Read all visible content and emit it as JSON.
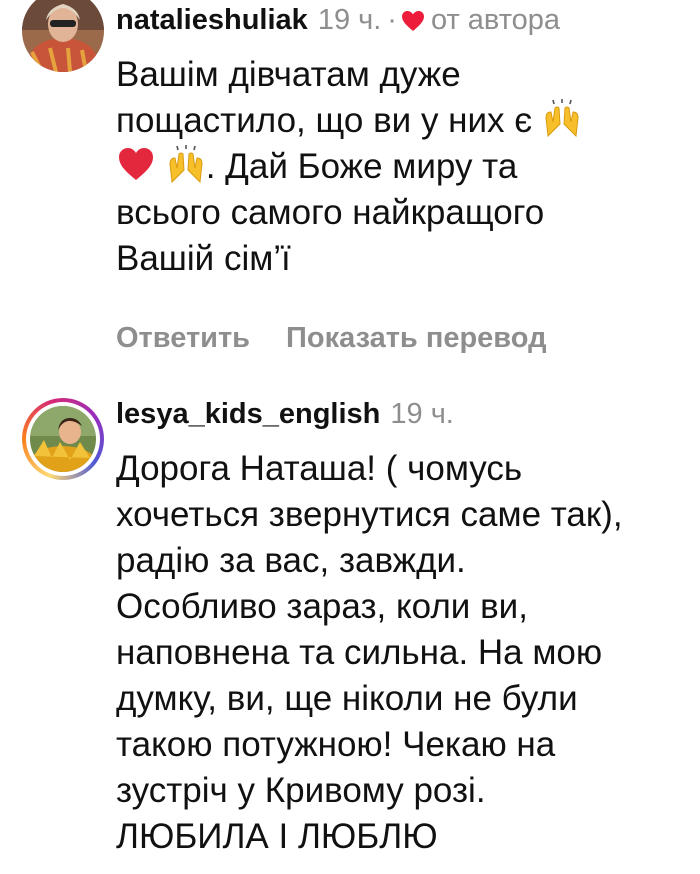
{
  "comments": [
    {
      "username": "natalieshuliak",
      "time": "19 ч.",
      "separator": "·",
      "author_badge": "от автора",
      "text_line1": "Вашім дівчатам дуже",
      "text_line2": "пощастило, що ви у них є",
      "text_line3": ". Дай Боже миру та",
      "text_line4": "всього самого найкращого",
      "text_line5": "Вашій сім’ї",
      "reply_label": "Ответить",
      "translate_label": "Показать перевод",
      "icons": [
        "raising-hands-icon",
        "red-heart-icon",
        "raising-hands-icon"
      ]
    },
    {
      "username": "lesya_kids_english",
      "time": "19 ч.",
      "text": "Дорога Наташа! ( чомусь\nхочеться звернутися саме так),\nрадію за  вас, завжди.\nОсобливо зараз, коли ви,\nнаповнена та сильна. На мою\nдумку, ви, ще ніколи не були\nтакою потужною! Чекаю на\nзустріч у Кривому розі.\nЛЮБИЛА І ЛЮБЛЮ"
    }
  ],
  "colors": {
    "text": "#111111",
    "secondary": "#8e8e8e",
    "heart": "#ed1c3a",
    "emoji_yellow": "#f7c02b"
  }
}
